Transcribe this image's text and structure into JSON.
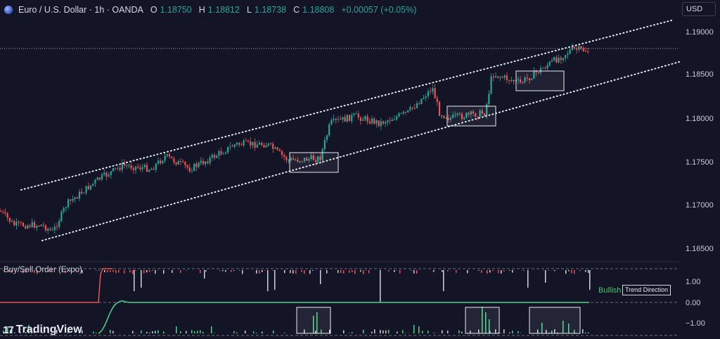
{
  "header": {
    "title": "Euro / U.S. Dollar · 1h · OANDA",
    "open_label": "O",
    "open": "1.18750",
    "high_label": "H",
    "high": "1.18812",
    "low_label": "L",
    "low": "1.18738",
    "close_label": "C",
    "close": "1.18808",
    "change": "+0.00057 (+0.05%)"
  },
  "currency_button": "USD",
  "price_axis": [
    "1.19000",
    "1.18500",
    "1.18000",
    "1.17500",
    "1.17000",
    "1.16500"
  ],
  "indicator": {
    "name": "Buy/Sell Order (Expo)",
    "axis": [
      "1.00",
      "0.00",
      "−1.00"
    ],
    "status": "Bullish",
    "badge": "Trend Direction"
  },
  "branding": {
    "logo_text": "TradingView",
    "logo_mark": "17"
  },
  "colors": {
    "background": "#131426",
    "up": "#26a69a",
    "down": "#ef5350",
    "bullish": "#3ec46d",
    "trend_line": "#4fd68a"
  }
}
